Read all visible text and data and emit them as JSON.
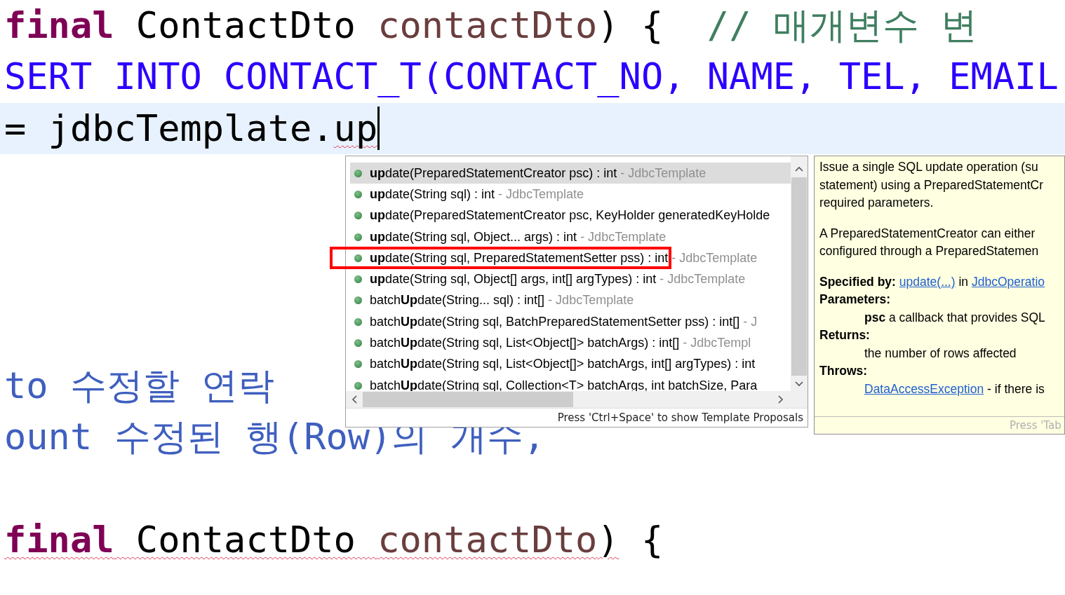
{
  "editor": {
    "lines": [
      {
        "kind": "code",
        "tokens": [
          {
            "text": "final",
            "kind": "keyword",
            "error": false
          },
          {
            "text": " ContactDto ",
            "kind": "plain",
            "error": false
          },
          {
            "text": "contactDto",
            "kind": "variable",
            "error": false
          },
          {
            "text": ") {  ",
            "kind": "plain",
            "error": false
          },
          {
            "text": "// 매개변수 변",
            "kind": "comment",
            "error": false
          }
        ]
      },
      {
        "kind": "code",
        "tokens": [
          {
            "text": "SERT INTO CONTACT_T(CONTACT_NO, NAME, TEL, EMAIL",
            "kind": "string",
            "error": false
          }
        ]
      },
      {
        "kind": "code",
        "current": true,
        "caret": true,
        "tokens": [
          {
            "text": "= jdbcTemplate.",
            "kind": "plain",
            "error": false
          },
          {
            "text": "up",
            "kind": "plain",
            "error": true
          }
        ]
      },
      {
        "kind": "blank"
      },
      {
        "kind": "blank"
      },
      {
        "kind": "blank"
      },
      {
        "kind": "blank"
      },
      {
        "kind": "code",
        "tokens": [
          {
            "text": "to 수정할 연락",
            "kind": "doc",
            "error": false
          }
        ]
      },
      {
        "kind": "code",
        "tokens": [
          {
            "text": "ount 수정된 행(Row)의 개수,",
            "kind": "doc",
            "error": false
          }
        ]
      },
      {
        "kind": "blank"
      },
      {
        "kind": "code",
        "tokens": [
          {
            "text": "final",
            "kind": "keyword",
            "error": true
          },
          {
            "text": " ContactDto ",
            "kind": "plain",
            "error": true
          },
          {
            "text": "contactDto",
            "kind": "variable",
            "error": true
          },
          {
            "text": ")",
            "kind": "plain",
            "error": true
          },
          {
            "text": " {",
            "kind": "plain",
            "error": false
          }
        ]
      }
    ]
  },
  "proposals": {
    "items": [
      {
        "label": "**up**date(PreparedStatementCreator psc) : int",
        "source": " - JdbcTemplate",
        "selected": true
      },
      {
        "label": "**up**date(String sql) : int",
        "source": " - JdbcTemplate",
        "selected": false
      },
      {
        "label": "**up**date(PreparedStatementCreator psc, KeyHolder generatedKeyHolde",
        "selected": false
      },
      {
        "label": "**up**date(String sql, Object... args) : int",
        "source": " - JdbcTemplate",
        "selected": false
      },
      {
        "label": "**up**date(String sql, PreparedStatementSetter pss) : int",
        "source": " - JdbcTemplate",
        "selected": false,
        "annotated": true
      },
      {
        "label": "**up**date(String sql, Object[] args, int[] argTypes) : int",
        "source": " - JdbcTemplate",
        "selected": false
      },
      {
        "label": "batch**Up**date(String... sql) : int[]",
        "source": " - JdbcTemplate",
        "selected": false
      },
      {
        "label": "batch**Up**date(String sql, BatchPreparedStatementSetter pss) : int[]",
        "source": " - J",
        "selected": false
      },
      {
        "label": "batch**Up**date(String sql, List<Object[]> batchArgs) : int[]",
        "source": " - JdbcTempl",
        "selected": false
      },
      {
        "label": "batch**Up**date(String sql, List<Object[]> batchArgs, int[] argTypes) : int",
        "selected": false
      },
      {
        "label": "batch**Up**date(String sql, Collection<T> batchArgs, int batchSize, Para",
        "selected": false
      }
    ],
    "footer": "Press 'Ctrl+Space' to show Template Proposals"
  },
  "javadoc": {
    "summary": [
      "Issue a single SQL update operation (su",
      "statement) using a PreparedStatementCr",
      "required parameters."
    ],
    "detail": [
      "A PreparedStatementCreator can either",
      "configured through a PreparedStatemen"
    ],
    "specified_label": "Specified by:",
    "specified_link": "update(...)",
    "specified_in": " in ",
    "specified_class": "JdbcOperatio",
    "params_label": "Parameters:",
    "param_name": "psc",
    "param_desc": " a callback that provides SQL",
    "returns_label": "Returns:",
    "returns_desc": "the number of rows affected",
    "throws_label": "Throws:",
    "throws_link": "DataAccessException",
    "throws_desc": " - if there is",
    "footer": "Press 'Tab"
  }
}
